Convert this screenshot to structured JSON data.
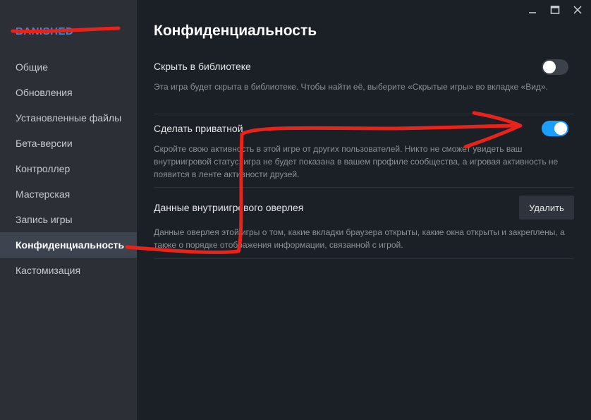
{
  "sidebar": {
    "game_title": "BANISHED",
    "items": [
      {
        "label": "Общие"
      },
      {
        "label": "Обновления"
      },
      {
        "label": "Установленные файлы"
      },
      {
        "label": "Бета-версии"
      },
      {
        "label": "Контроллер"
      },
      {
        "label": "Мастерская"
      },
      {
        "label": "Запись игры"
      },
      {
        "label": "Конфиденциальность",
        "active": true
      },
      {
        "label": "Кастомизация"
      }
    ]
  },
  "window": {
    "minimize_icon": "minimize-icon",
    "maximize_icon": "maximize-icon",
    "close_icon": "close-icon"
  },
  "main": {
    "title": "Конфиденциальность",
    "settings": [
      {
        "label": "Скрыть в библиотеке",
        "description": "Эта игра будет скрыта в библиотеке. Чтобы найти её, выберите «Скрытые игры» во вкладке «Вид».",
        "toggle_on": false
      },
      {
        "label": "Сделать приватной",
        "description": "Скройте свою активность в этой игре от других пользователей. Никто не сможет увидеть ваш внутриигровой статус, игра не будет показана в вашем профиле сообщества, а игровая активность не появится в ленте активности друзей.",
        "toggle_on": true
      },
      {
        "label": "Данные внутриигрового оверлея",
        "description": "Данные оверлея этой игры о том, какие вкладки браузера открыты, какие окна открыты и закреплены, а также о порядке отображения информации, связанной с игрой.",
        "button_label": "Удалить"
      }
    ]
  },
  "colors": {
    "accent": "#1a9fff",
    "sidebar_bg": "#2c2f35",
    "main_bg": "#1b1f26",
    "annotation": "#e8231c"
  }
}
